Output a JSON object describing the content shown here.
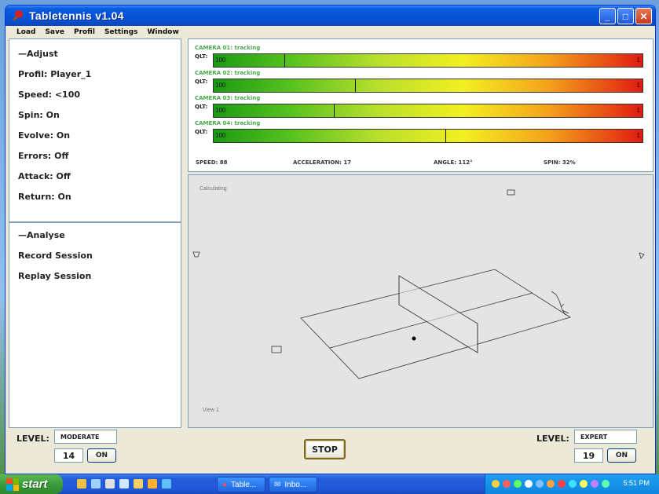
{
  "window": {
    "title": "Tabletennis  v1.04"
  },
  "menu": [
    "Load",
    "Save",
    "Profil",
    "Settings",
    "Window"
  ],
  "adjust": {
    "header": "—Adjust",
    "options": [
      "Profil:  Player_1",
      "Speed: <100",
      "Spin: On",
      "Evolve: On",
      "Errors: Off",
      "Attack: Off",
      "Return: On"
    ]
  },
  "analyse": {
    "header": "—Analyse",
    "options": [
      "Record Session",
      "Replay Session"
    ]
  },
  "cameras": [
    {
      "label": "CAMERA 01: tracking",
      "qlt": "QLT:",
      "left": "100",
      "right": "1",
      "marker": 0.165
    },
    {
      "label": "CAMERA 02: tracking",
      "qlt": "QLT:",
      "left": "100",
      "right": "1",
      "marker": 0.33
    },
    {
      "label": "CAMERA 03: tracking",
      "qlt": "QLT:",
      "left": "100",
      "right": "1",
      "marker": 0.28
    },
    {
      "label": "CAMERA 04: tracking",
      "qlt": "QLT:",
      "left": "100",
      "right": "1",
      "marker": 0.54
    }
  ],
  "stats": {
    "speed": "SPEED: 88",
    "acceleration": "ACCELERATION: 17",
    "angle": "ANGLE: 112°",
    "spin": "SPIN: 32%"
  },
  "view": {
    "status": "Calculating",
    "name": "View 1"
  },
  "left_level": {
    "label": "LEVEL:",
    "value": "MODERATE",
    "number": "14",
    "toggle": "ON"
  },
  "right_level": {
    "label": "LEVEL:",
    "value": "EXPERT",
    "number": "19",
    "toggle": "ON"
  },
  "stop_label": "STOP",
  "taskbar": {
    "start": "start",
    "tasks": [
      "Table...",
      "Inbo..."
    ],
    "clock": "5:51 PM"
  },
  "colors": {
    "title_bar": "#0554d8",
    "tracking_label": "#4aa84a",
    "taskbar": "#245edb"
  }
}
